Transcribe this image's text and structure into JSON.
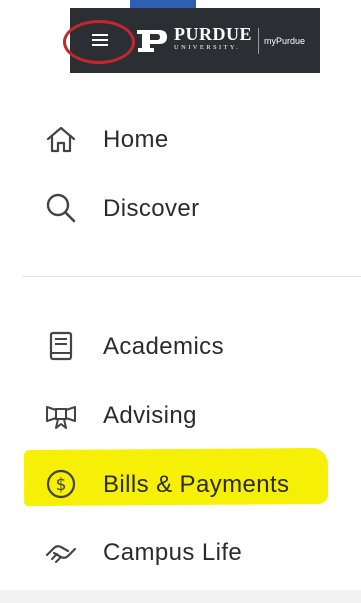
{
  "header": {
    "logo_name": "PURDUE",
    "logo_sub": "UNIVERSITY.",
    "app_name": "myPurdue"
  },
  "nav": {
    "primary": [
      {
        "label": "Home",
        "icon": "home-icon"
      },
      {
        "label": "Discover",
        "icon": "search-icon"
      }
    ],
    "secondary": [
      {
        "label": "Academics",
        "icon": "book-icon"
      },
      {
        "label": "Advising",
        "icon": "ribbon-icon"
      },
      {
        "label": "Bills & Payments",
        "icon": "dollar-circle-icon"
      },
      {
        "label": "Campus Life",
        "icon": "handshake-icon"
      }
    ]
  },
  "annotations": {
    "circle_color": "#c2262e",
    "highlight_color": "#f5f005"
  }
}
